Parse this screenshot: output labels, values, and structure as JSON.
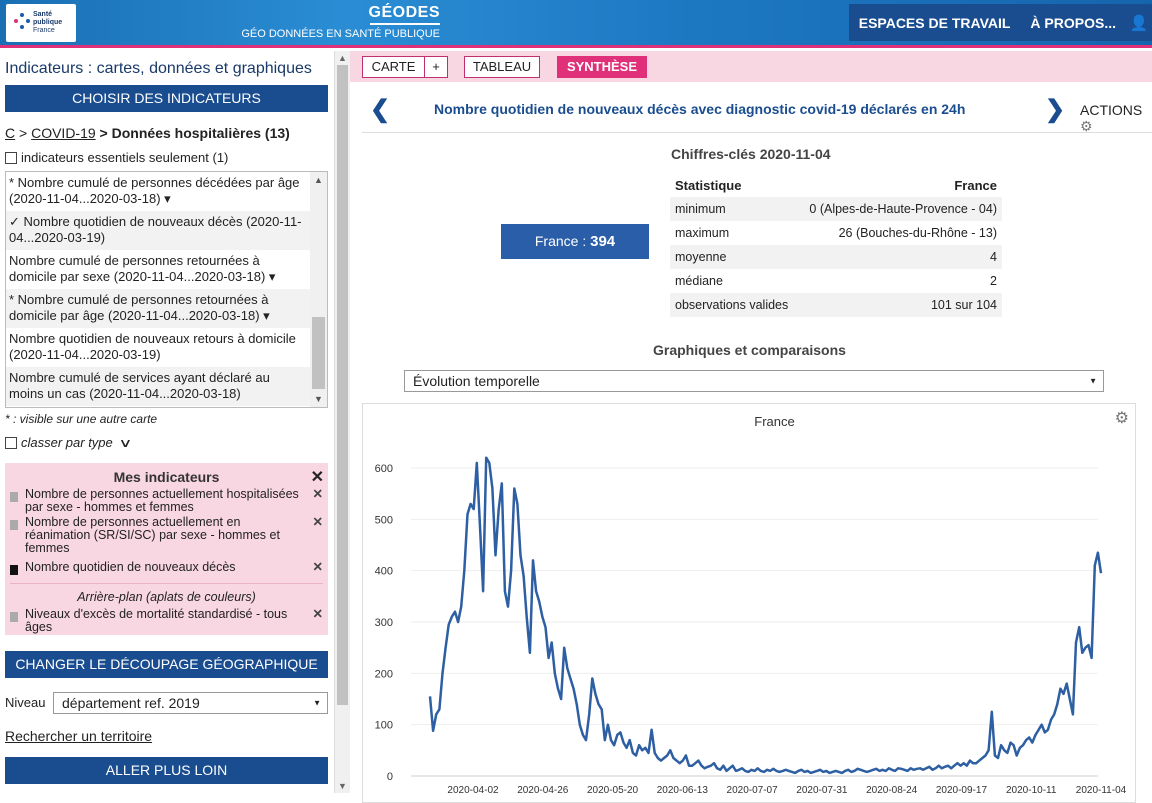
{
  "header": {
    "logo_lines": [
      "Santé",
      "publique",
      "France"
    ],
    "app_title": "GÉODES",
    "app_subtitle": "GÉO DONNÉES EN SANTÉ PUBLIQUE",
    "nav": [
      "ESPACES DE TRAVAIL",
      "À PROPOS..."
    ]
  },
  "left": {
    "title": "Indicateurs : cartes, données et graphiques",
    "choose_btn": "CHOISIR DES INDICATEURS",
    "breadcrumb": {
      "root": "C",
      "sep1": " > ",
      "l1": "COVID-19",
      "sep2": " > ",
      "current": "Données hospitalières (13)"
    },
    "essentials": "indicateurs essentiels seulement (1)",
    "indicators": [
      {
        "text": "* Nombre cumulé de personnes décédées par âge (2020-11-04...2020-03-18) ▾"
      },
      {
        "text": "✓ Nombre quotidien de nouveaux décès (2020-11-04...2020-03-19)"
      },
      {
        "text": "Nombre cumulé de personnes retournées à domicile par sexe (2020-11-04...2020-03-18) ▾"
      },
      {
        "text": "* Nombre cumulé de personnes retournées à domicile par âge (2020-11-04...2020-03-18) ▾"
      },
      {
        "text": "Nombre quotidien de nouveaux retours à domicile (2020-11-04...2020-03-19)"
      },
      {
        "text": "Nombre cumulé de services ayant déclaré au moins un cas (2020-11-04...2020-03-18)"
      }
    ],
    "visible_note": "* : visible sur une autre carte",
    "by_type": "classer par type",
    "mes": {
      "title": "Mes indicateurs",
      "items": [
        "Nombre de personnes actuellement hospitalisées par sexe - hommes et femmes",
        "Nombre de personnes actuellement en réanimation (SR/SI/SC) par sexe - hommes et femmes",
        "Nombre quotidien de nouveaux décès"
      ],
      "bg_title": "Arrière-plan (aplats de couleurs)",
      "bg_item": "Niveaux d'excès de mortalité standardisé - tous âges"
    },
    "change_btn": "CHANGER LE DÉCOUPAGE GÉOGRAPHIQUE",
    "level_label": "Niveau",
    "level_value": "département ref. 2019",
    "search_link": "Rechercher un territoire",
    "more_btn": "ALLER PLUS LOIN"
  },
  "right": {
    "tabs": {
      "carte": "CARTE",
      "plus": "+",
      "tableau": "TABLEAU",
      "synthese": "SYNTHÈSE"
    },
    "title": "Nombre quotidien de nouveaux décès avec diagnostic covid-19 déclarés en 24h",
    "actions": "ACTIONS",
    "keyfigs": "Chiffres-clés 2020-11-04",
    "france_label": "France : ",
    "france_value": "394",
    "stats": {
      "h1": "Statistique",
      "h2": "France",
      "rows": [
        {
          "k": "minimum",
          "v": "0 (Alpes-de-Haute-Provence - 04)"
        },
        {
          "k": "maximum",
          "v": "26 (Bouches-du-Rhône - 13)"
        },
        {
          "k": "moyenne",
          "v": "4"
        },
        {
          "k": "médiane",
          "v": "2"
        },
        {
          "k": "observations valides",
          "v": "101 sur 104"
        }
      ]
    },
    "graphs_title": "Graphiques et comparaisons",
    "graph_select": "Évolution temporelle",
    "colors": {
      "line": "#2e5fa3",
      "accent": "#e0307a",
      "navy": "#1a4d8f"
    }
  },
  "chart_data": {
    "type": "line",
    "title": "France",
    "ylim": [
      0,
      600
    ],
    "yticks": [
      0,
      100,
      200,
      300,
      400,
      500,
      600
    ],
    "xticks": [
      "2020-04-02",
      "2020-04-26",
      "2020-05-20",
      "2020-06-13",
      "2020-07-07",
      "2020-07-31",
      "2020-08-24",
      "2020-09-17",
      "2020-10-11",
      "2020-11-04"
    ],
    "series": [
      {
        "values": [
          155,
          88,
          120,
          130,
          200,
          250,
          295,
          310,
          320,
          300,
          330,
          400,
          510,
          530,
          520,
          610,
          490,
          360,
          620,
          610,
          560,
          430,
          520,
          570,
          360,
          330,
          400,
          560,
          530,
          430,
          390,
          310,
          240,
          420,
          360,
          340,
          310,
          290,
          230,
          260,
          200,
          170,
          150,
          250,
          210,
          190,
          170,
          140,
          100,
          80,
          70,
          120,
          190,
          160,
          140,
          130,
          70,
          100,
          70,
          60,
          80,
          85,
          65,
          55,
          70,
          45,
          40,
          60,
          50,
          55,
          45,
          90,
          45,
          35,
          30,
          35,
          40,
          50,
          35,
          30,
          25,
          30,
          40,
          20,
          20,
          25,
          30,
          20,
          15,
          18,
          20,
          25,
          15,
          12,
          20,
          10,
          15,
          20,
          10,
          12,
          15,
          10,
          8,
          12,
          10,
          15,
          10,
          8,
          12,
          10,
          14,
          10,
          8,
          10,
          12,
          10,
          8,
          6,
          10,
          12,
          8,
          10,
          6,
          8,
          10,
          12,
          8,
          10,
          6,
          8,
          10,
          8,
          6,
          10,
          12,
          8,
          10,
          14,
          12,
          10,
          8,
          10,
          12,
          14,
          10,
          12,
          10,
          15,
          12,
          10,
          15,
          14,
          12,
          10,
          15,
          12,
          14,
          15,
          12,
          15,
          18,
          12,
          15,
          20,
          15,
          18,
          20,
          15,
          20,
          25,
          20,
          25,
          20,
          30,
          25,
          25,
          30,
          35,
          40,
          50,
          125,
          40,
          35,
          60,
          50,
          45,
          65,
          60,
          40,
          55,
          60,
          70,
          75,
          65,
          80,
          90,
          100,
          85,
          90,
          110,
          120,
          140,
          170,
          160,
          180,
          150,
          120,
          260,
          290,
          240,
          250,
          255,
          230,
          410,
          435,
          395
        ]
      }
    ]
  }
}
